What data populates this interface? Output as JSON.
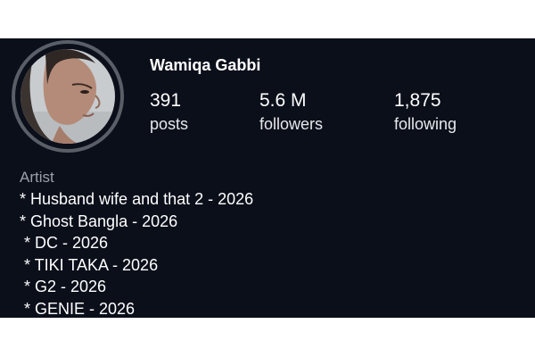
{
  "profile": {
    "name": "Wamiqa Gabbi",
    "stats": [
      {
        "value": "391",
        "label": "posts"
      },
      {
        "value": "5.6 M",
        "label": "followers"
      },
      {
        "value": "1,875",
        "label": "following"
      }
    ],
    "category": "Artist",
    "bio_lines": [
      "* Husband wife and that 2 - 2026",
      "* Ghost Bangla - 2026",
      " * DC - 2026",
      " * TIKI TAKA - 2026",
      " * G2 - 2026",
      " * GENIE - 2026"
    ]
  },
  "colors": {
    "panel_background": "#0b0f1a",
    "avatar_ring": "#5a5e66",
    "text_primary": "#ffffff",
    "text_secondary": "#9aa0aa"
  }
}
